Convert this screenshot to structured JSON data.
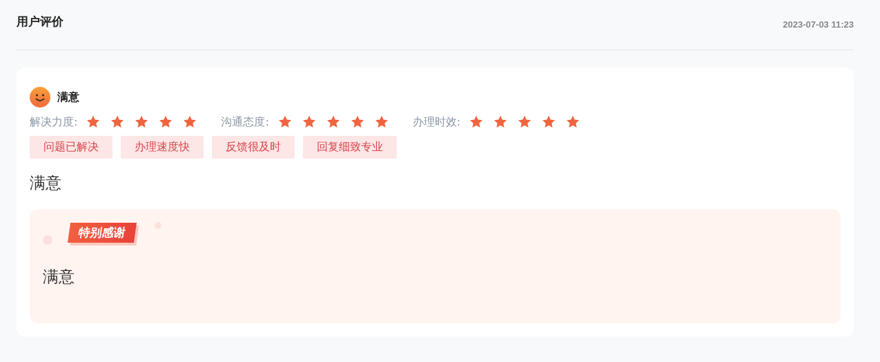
{
  "header": {
    "title": "用户评价",
    "time": "2023-07-03 11:23"
  },
  "review": {
    "mood": "满意",
    "ratings": [
      {
        "label": "解决力度:",
        "stars": 5
      },
      {
        "label": "沟通态度:",
        "stars": 5
      },
      {
        "label": "办理时效:",
        "stars": 5
      }
    ],
    "tags": [
      "问题已解决",
      "办理速度快",
      "反馈很及时",
      "回复细致专业"
    ],
    "comment": "满意",
    "thanks": {
      "badge": "特别感谢",
      "text": "满意"
    }
  }
}
